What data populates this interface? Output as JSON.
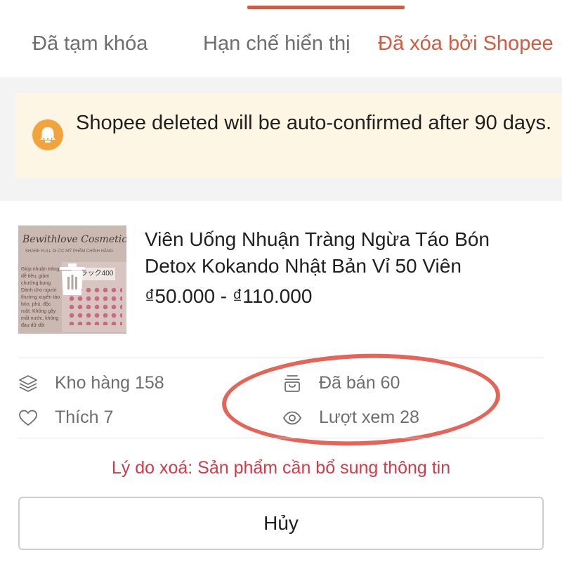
{
  "tabs": [
    {
      "label": "Đã tạm khóa"
    },
    {
      "label": "Hạn chế hiển thị"
    },
    {
      "label": "Đã xóa bởi Shopee",
      "active": true
    }
  ],
  "colors": {
    "accent": "#d65a3e",
    "notice_bg": "#fdf6e4",
    "warning_icon": "#f2a33b",
    "reason": "#d33a48",
    "annotation": "#e66357"
  },
  "notice": {
    "icon": "bell-icon",
    "text": "Shopee deleted will be auto-confirmed after 90 days."
  },
  "product": {
    "thumbnail": {
      "brand": "Bewithlove Cosmetics",
      "subtitle": "SHARE FULL DI ỨC MỸ PHẨM CHÍNH HÃNG",
      "side_text": "Giúp nhuận tràng, dễ tiêu, giảm chướng bụng. Dành cho người thường xuyên táo bón, phù, độc ruột. Không gây mất nước, không đau dữ dội",
      "package_label": "ーラック400",
      "overlay_icon": "trash-icon"
    },
    "title": "Viên Uống Nhuận Tràng Ngừa Táo Bón Detox Kokando Nhật Bản Vỉ 50 Viên",
    "price": "₫50.000 - ₫110.000"
  },
  "stats": {
    "stock": {
      "icon": "layers-icon",
      "label": "Kho hàng 158"
    },
    "likes": {
      "icon": "heart-icon",
      "label": "Thích 7"
    },
    "sold": {
      "icon": "basket-icon",
      "label": "Đã bán 60"
    },
    "views": {
      "icon": "eye-icon",
      "label": "Lượt xem 28"
    }
  },
  "reason": "Lý do xoá: Sản phẩm cần bổ sung thông tin",
  "cancel_label": "Hủy"
}
